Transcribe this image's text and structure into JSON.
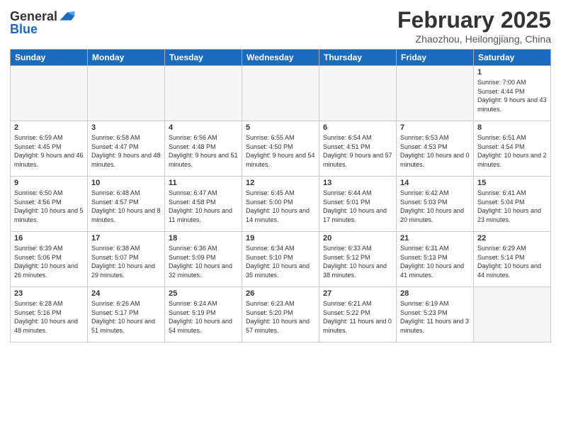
{
  "logo": {
    "line1": "General",
    "line2": "Blue"
  },
  "title": "February 2025",
  "location": "Zhaozhou, Heilongjiang, China",
  "days_of_week": [
    "Sunday",
    "Monday",
    "Tuesday",
    "Wednesday",
    "Thursday",
    "Friday",
    "Saturday"
  ],
  "weeks": [
    [
      {
        "num": "",
        "info": ""
      },
      {
        "num": "",
        "info": ""
      },
      {
        "num": "",
        "info": ""
      },
      {
        "num": "",
        "info": ""
      },
      {
        "num": "",
        "info": ""
      },
      {
        "num": "",
        "info": ""
      },
      {
        "num": "1",
        "info": "Sunrise: 7:00 AM\nSunset: 4:44 PM\nDaylight: 9 hours and 43 minutes."
      }
    ],
    [
      {
        "num": "2",
        "info": "Sunrise: 6:59 AM\nSunset: 4:45 PM\nDaylight: 9 hours and 46 minutes."
      },
      {
        "num": "3",
        "info": "Sunrise: 6:58 AM\nSunset: 4:47 PM\nDaylight: 9 hours and 48 minutes."
      },
      {
        "num": "4",
        "info": "Sunrise: 6:56 AM\nSunset: 4:48 PM\nDaylight: 9 hours and 51 minutes."
      },
      {
        "num": "5",
        "info": "Sunrise: 6:55 AM\nSunset: 4:50 PM\nDaylight: 9 hours and 54 minutes."
      },
      {
        "num": "6",
        "info": "Sunrise: 6:54 AM\nSunset: 4:51 PM\nDaylight: 9 hours and 57 minutes."
      },
      {
        "num": "7",
        "info": "Sunrise: 6:53 AM\nSunset: 4:53 PM\nDaylight: 10 hours and 0 minutes."
      },
      {
        "num": "8",
        "info": "Sunrise: 6:51 AM\nSunset: 4:54 PM\nDaylight: 10 hours and 2 minutes."
      }
    ],
    [
      {
        "num": "9",
        "info": "Sunrise: 6:50 AM\nSunset: 4:56 PM\nDaylight: 10 hours and 5 minutes."
      },
      {
        "num": "10",
        "info": "Sunrise: 6:48 AM\nSunset: 4:57 PM\nDaylight: 10 hours and 8 minutes."
      },
      {
        "num": "11",
        "info": "Sunrise: 6:47 AM\nSunset: 4:58 PM\nDaylight: 10 hours and 11 minutes."
      },
      {
        "num": "12",
        "info": "Sunrise: 6:45 AM\nSunset: 5:00 PM\nDaylight: 10 hours and 14 minutes."
      },
      {
        "num": "13",
        "info": "Sunrise: 6:44 AM\nSunset: 5:01 PM\nDaylight: 10 hours and 17 minutes."
      },
      {
        "num": "14",
        "info": "Sunrise: 6:42 AM\nSunset: 5:03 PM\nDaylight: 10 hours and 20 minutes."
      },
      {
        "num": "15",
        "info": "Sunrise: 6:41 AM\nSunset: 5:04 PM\nDaylight: 10 hours and 23 minutes."
      }
    ],
    [
      {
        "num": "16",
        "info": "Sunrise: 6:39 AM\nSunset: 5:06 PM\nDaylight: 10 hours and 26 minutes."
      },
      {
        "num": "17",
        "info": "Sunrise: 6:38 AM\nSunset: 5:07 PM\nDaylight: 10 hours and 29 minutes."
      },
      {
        "num": "18",
        "info": "Sunrise: 6:36 AM\nSunset: 5:09 PM\nDaylight: 10 hours and 32 minutes."
      },
      {
        "num": "19",
        "info": "Sunrise: 6:34 AM\nSunset: 5:10 PM\nDaylight: 10 hours and 35 minutes."
      },
      {
        "num": "20",
        "info": "Sunrise: 6:33 AM\nSunset: 5:12 PM\nDaylight: 10 hours and 38 minutes."
      },
      {
        "num": "21",
        "info": "Sunrise: 6:31 AM\nSunset: 5:13 PM\nDaylight: 10 hours and 41 minutes."
      },
      {
        "num": "22",
        "info": "Sunrise: 6:29 AM\nSunset: 5:14 PM\nDaylight: 10 hours and 44 minutes."
      }
    ],
    [
      {
        "num": "23",
        "info": "Sunrise: 6:28 AM\nSunset: 5:16 PM\nDaylight: 10 hours and 48 minutes."
      },
      {
        "num": "24",
        "info": "Sunrise: 6:26 AM\nSunset: 5:17 PM\nDaylight: 10 hours and 51 minutes."
      },
      {
        "num": "25",
        "info": "Sunrise: 6:24 AM\nSunset: 5:19 PM\nDaylight: 10 hours and 54 minutes."
      },
      {
        "num": "26",
        "info": "Sunrise: 6:23 AM\nSunset: 5:20 PM\nDaylight: 10 hours and 57 minutes."
      },
      {
        "num": "27",
        "info": "Sunrise: 6:21 AM\nSunset: 5:22 PM\nDaylight: 11 hours and 0 minutes."
      },
      {
        "num": "28",
        "info": "Sunrise: 6:19 AM\nSunset: 5:23 PM\nDaylight: 11 hours and 3 minutes."
      },
      {
        "num": "",
        "info": ""
      }
    ]
  ]
}
